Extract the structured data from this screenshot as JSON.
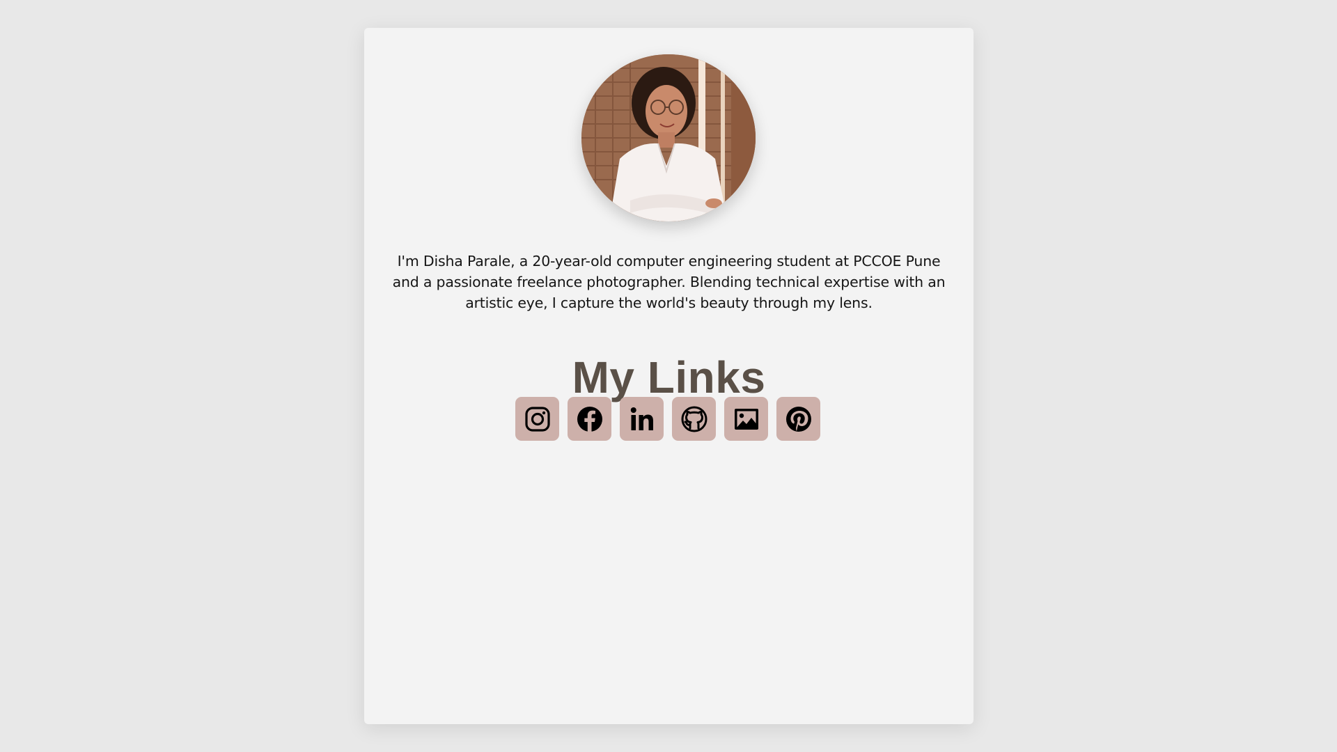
{
  "profile": {
    "avatar_alt": "Profile photo",
    "bio": "I'm Disha Parale, a 20-year-old computer engineering student at PCCOE Pune and a passionate freelance photographer. Blending technical expertise with an artistic eye, I capture the world's beauty through my lens."
  },
  "links": {
    "title": "My Links",
    "items": [
      {
        "icon": "instagram-icon"
      },
      {
        "icon": "facebook-icon"
      },
      {
        "icon": "linkedin-icon"
      },
      {
        "icon": "github-icon"
      },
      {
        "icon": "image-gallery-icon"
      },
      {
        "icon": "pinterest-icon"
      }
    ]
  },
  "colors": {
    "page_background": "#e8e8e8",
    "card_background": "#f3f3f3",
    "title_color": "#5a5047",
    "icon_button_background": "#cdb0aa",
    "icon_color": "#000000"
  }
}
